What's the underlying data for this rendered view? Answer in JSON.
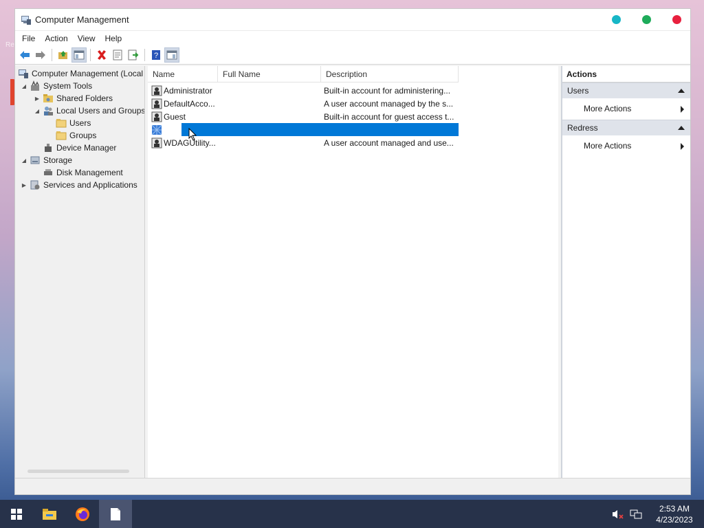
{
  "desktop": {
    "label": "Re"
  },
  "window": {
    "title": "Computer Management",
    "title_dots": {
      "color1": "#17b6c6",
      "color2": "#1eab5a",
      "color3": "#e8203e"
    }
  },
  "menu": [
    "File",
    "Action",
    "View",
    "Help"
  ],
  "tree": {
    "root": "Computer Management (Local",
    "system_tools": "System Tools",
    "shared_folders": "Shared Folders",
    "local_users_groups": "Local Users and Groups",
    "users": "Users",
    "groups": "Groups",
    "device_manager": "Device Manager",
    "storage": "Storage",
    "disk_management": "Disk Management",
    "services_apps": "Services and Applications"
  },
  "list": {
    "columns": [
      "Name",
      "Full Name",
      "Description"
    ],
    "rows": [
      {
        "name": "Administrator",
        "full_name": "",
        "description": "Built-in account for administering..."
      },
      {
        "name": "DefaultAcco...",
        "full_name": "",
        "description": "A user account managed by the s..."
      },
      {
        "name": "Guest",
        "full_name": "",
        "description": "Built-in account for guest access t..."
      },
      {
        "name": "",
        "full_name": "",
        "description": ""
      },
      {
        "name": "WDAGUtility...",
        "full_name": "",
        "description": "A user account managed and use..."
      }
    ]
  },
  "actions": {
    "title": "Actions",
    "sections": [
      {
        "label": "Users",
        "item": "More Actions"
      },
      {
        "label": "Redress",
        "item": "More Actions"
      }
    ]
  },
  "taskbar": {
    "time": "2:53 AM",
    "date": "4/23/2023"
  },
  "colors": {
    "accent": "#0078d7",
    "taskbar": "#27324a"
  }
}
